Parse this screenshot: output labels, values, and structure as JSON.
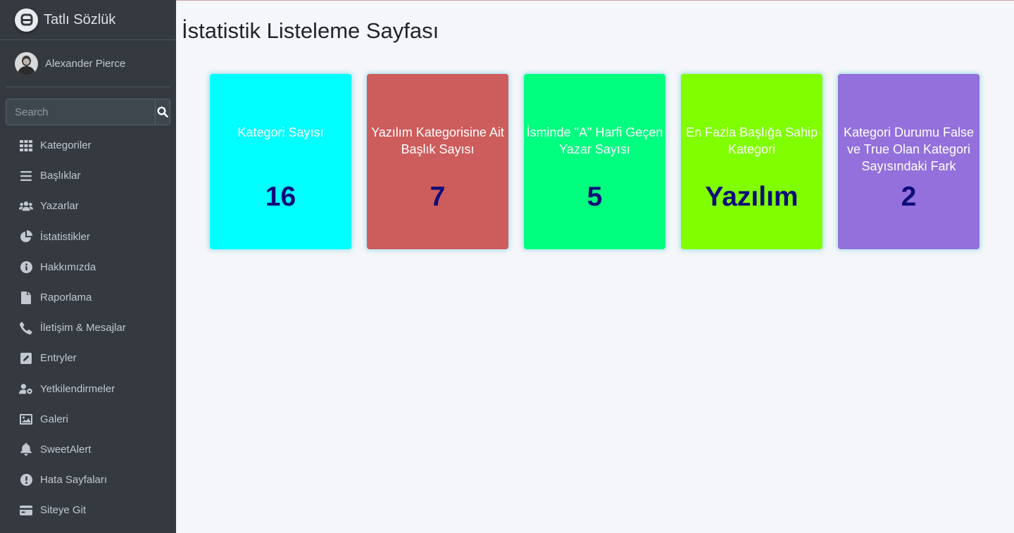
{
  "brand": {
    "title": "Tatlı Sözlük"
  },
  "user": {
    "name": "Alexander Pierce"
  },
  "search": {
    "placeholder": "Search"
  },
  "sidebar": {
    "items": [
      {
        "label": "Kategoriler",
        "icon": "grid-icon"
      },
      {
        "label": "Başlıklar",
        "icon": "bars-icon"
      },
      {
        "label": "Yazarlar",
        "icon": "users-icon"
      },
      {
        "label": "İstatistikler",
        "icon": "pie-chart-icon"
      },
      {
        "label": "Hakkımızda",
        "icon": "info-icon"
      },
      {
        "label": "Raporlama",
        "icon": "file-icon"
      },
      {
        "label": "İletişim & Mesajlar",
        "icon": "phone-icon"
      },
      {
        "label": "Entryler",
        "icon": "edit-icon"
      },
      {
        "label": "Yetkilendirmeler",
        "icon": "user-cog-icon"
      },
      {
        "label": "Galeri",
        "icon": "image-icon"
      },
      {
        "label": "SweetAlert",
        "icon": "bell-icon"
      },
      {
        "label": "Hata Sayfaları",
        "icon": "exclamation-icon"
      },
      {
        "label": "Siteye Git",
        "icon": "card-icon"
      }
    ]
  },
  "page": {
    "title": "İstatistik Listeleme Sayfası"
  },
  "cards": [
    {
      "title": "Kategori Sayısı",
      "value": "16",
      "color": "#00ffff"
    },
    {
      "title": "Yazılım Kategorisine Ait Başlık Sayısı",
      "value": "7",
      "color": "#cd5c5c"
    },
    {
      "title": "İsminde \"A\" Harfi Geçen Yazar Sayısı",
      "value": "5",
      "color": "#00ff7f"
    },
    {
      "title": "En Fazla Başlığa Sahip Kategori",
      "value": "Yazılım",
      "color": "#7fff00"
    },
    {
      "title": "Kategori Durumu False ve True Olan Kategori Sayısındaki Fark",
      "value": "2",
      "color": "#9370db"
    }
  ]
}
